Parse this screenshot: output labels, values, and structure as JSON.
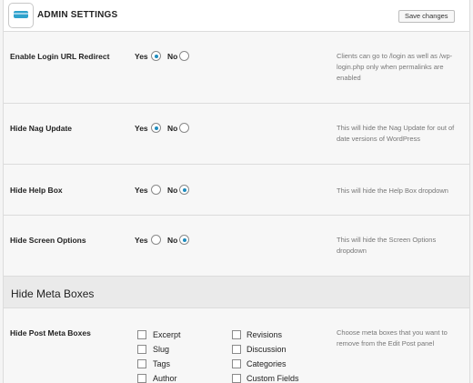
{
  "header": {
    "title": "ADMIN SETTINGS",
    "save_label": "Save changes",
    "accent_color": "#2ea2cc"
  },
  "settings": [
    {
      "label": "Enable Login URL Redirect",
      "yes": "Yes",
      "no": "No",
      "selected": "yes",
      "description": "Clients can go to /login as well as /wp-login.php only when permalinks are enabled"
    },
    {
      "label": "Hide Nag Update",
      "yes": "Yes",
      "no": "No",
      "selected": "yes",
      "description": "This will hide the Nag Update for out of date versions of WordPress"
    },
    {
      "label": "Hide Help Box",
      "yes": "Yes",
      "no": "No",
      "selected": "no",
      "description": "This will hide the Help Box dropdown"
    },
    {
      "label": "Hide Screen Options",
      "yes": "Yes",
      "no": "No",
      "selected": "no",
      "description": "This will hide the Screen Options dropdown"
    }
  ],
  "meta_section": {
    "title": "Hide Meta Boxes",
    "post_label": "Hide Post Meta Boxes",
    "post_description": "Choose meta boxes that you want to remove from the Edit Post panel",
    "col1": [
      "Excerpt",
      "Slug",
      "Tags",
      "Author"
    ],
    "col2": [
      "Revisions",
      "Discussion",
      "Categories",
      "Custom Fields"
    ]
  }
}
